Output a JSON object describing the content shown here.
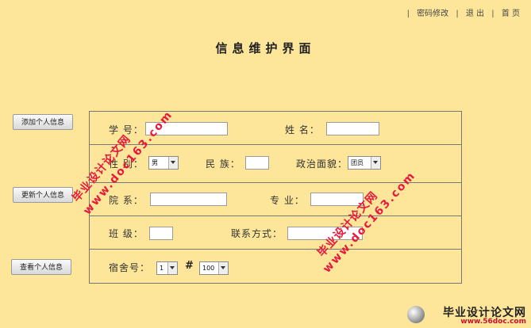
{
  "topnav": {
    "separator": "|",
    "password": "密码修改",
    "logout": "退 出",
    "home": "首 页"
  },
  "title": "信息维护界面",
  "side": {
    "add": "添加个人信息",
    "update": "更新个人信息",
    "view": "查看个人信息"
  },
  "form": {
    "student_id_label": "学 号：",
    "name_label": "姓 名：",
    "gender_label": "性 别：",
    "gender_value": "男",
    "ethnicity_label": "民 族：",
    "political_label": "政治面貌：",
    "political_value": "团员",
    "department_label": "院 系：",
    "major_label": "专 业：",
    "class_label": "班 级：",
    "contact_label": "联系方式：",
    "dorm_label": "宿舍号：",
    "dorm_building_value": "1",
    "dorm_hash": "#",
    "dorm_room_value": "100"
  },
  "watermarks": {
    "cn": "毕业设计论文网",
    "url": "www.doc163.com"
  },
  "logo": {
    "title": "毕业设计论文网",
    "url": "www.56doc.com"
  }
}
